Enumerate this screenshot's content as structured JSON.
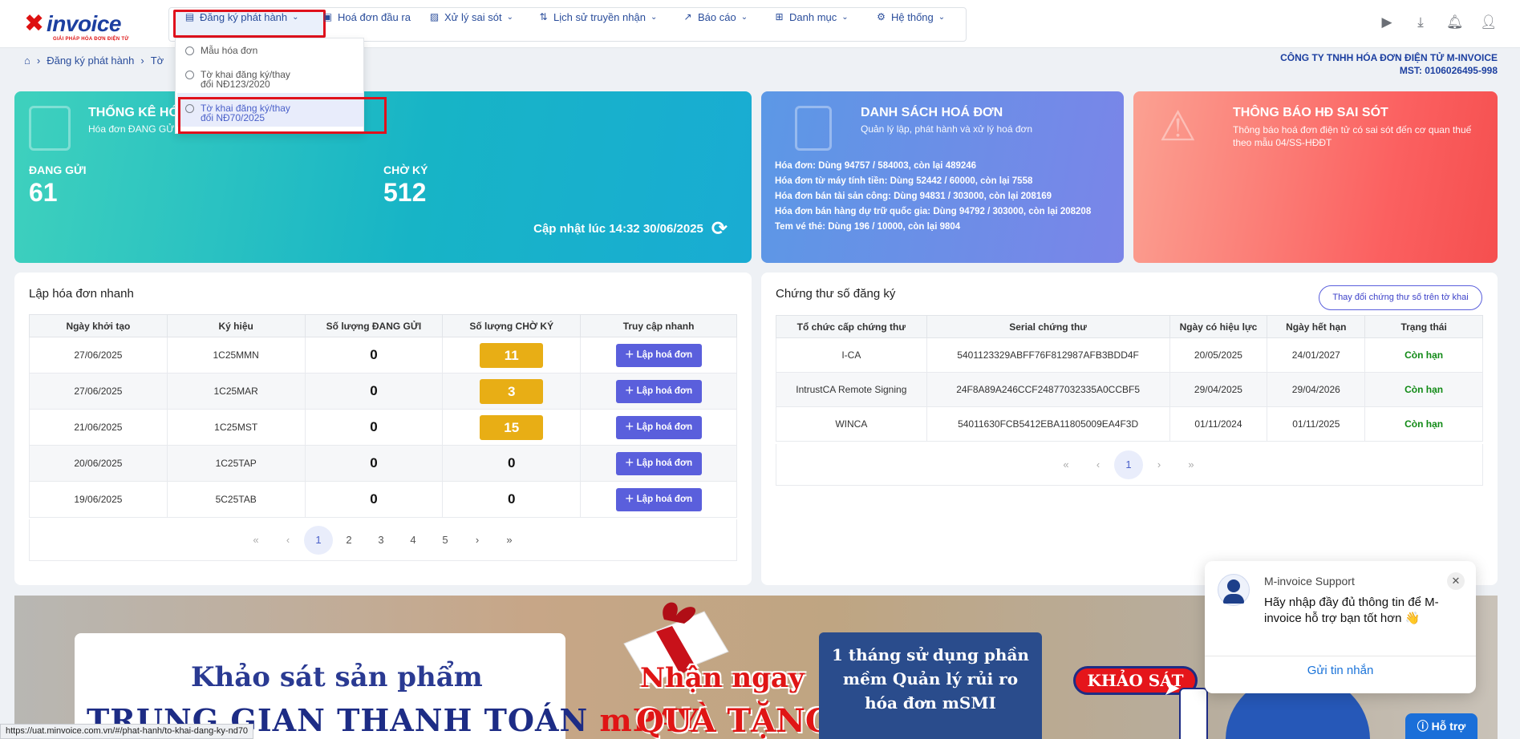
{
  "logo": {
    "mark": "✖",
    "word": "invoice",
    "tagline": "GIẢI PHÁP HÓA ĐƠN ĐIỆN TỬ"
  },
  "nav": [
    {
      "label": "Đăng ký phát hành",
      "icon": "file-register-icon"
    },
    {
      "label": "Hoá đơn đầu ra",
      "icon": "invoice-out-icon"
    },
    {
      "label": "Xử lý sai sót",
      "icon": "error-handling-icon"
    },
    {
      "label": "Lịch sử truyền nhận",
      "icon": "transfer-history-icon"
    },
    {
      "label": "Báo cáo",
      "icon": "chart-icon"
    },
    {
      "label": "Danh mục",
      "icon": "grid-icon"
    },
    {
      "label": "Hệ thống",
      "icon": "gear-icon"
    }
  ],
  "dropdown": {
    "items": [
      "Mẫu hóa đơn",
      "Tờ khai đăng ký/thay đổi NĐ123/2020",
      "Tờ khai đăng ký/thay đổi NĐ70/2025"
    ]
  },
  "breadcrumb": {
    "items": [
      "Đăng ký phát hành",
      "Tờ"
    ]
  },
  "company": {
    "name": "CÔNG TY TNHH HÓA ĐƠN ĐIỆN TỬ M-INVOICE",
    "mst": "MST: 0106026495-998"
  },
  "card_stats": {
    "title": "THỐNG KÊ HÓ",
    "subtitle": "Hóa đơn ĐANG GỬ",
    "sending_label": "ĐANG GỬI",
    "sending_value": "61",
    "pending_label": "CHỜ KÝ",
    "pending_value": "512",
    "updated": "Cập nhật lúc 14:32 30/06/2025"
  },
  "card_invoices": {
    "title": "DANH SÁCH HOÁ ĐƠN",
    "subtitle": "Quản lý lập, phát hành và xử lý hoá đơn",
    "lines": [
      "Hóa đơn: Dùng 94757 / 584003, còn lại 489246",
      "Hóa đơn từ máy tính tiền: Dùng 52442 / 60000, còn lại 7558",
      "Hóa đơn bán tài sản công: Dùng 94831 / 303000, còn lại 208169",
      "Hóa đơn bán hàng dự trữ quốc gia: Dùng 94792 / 303000, còn lại 208208",
      "Tem vé thẻ: Dùng 196 / 10000, còn lại 9804"
    ]
  },
  "card_errors": {
    "title": "THÔNG BÁO HĐ SAI SÓT",
    "subtitle": "Thông báo hoá đơn điện tử có sai sót đến cơ quan thuế theo mẫu 04/SS-HĐĐT"
  },
  "quick_invoice": {
    "title": "Lập hóa đơn nhanh",
    "headers": [
      "Ngày khởi tạo",
      "Ký hiệu",
      "Số lượng ĐANG GỬI",
      "Số lượng CHỜ KÝ",
      "Truy cập nhanh"
    ],
    "button_label": "Lập hoá đơn",
    "rows": [
      {
        "date": "27/06/2025",
        "symbol": "1C25MMN",
        "sending": "0",
        "pending": "11"
      },
      {
        "date": "27/06/2025",
        "symbol": "1C25MAR",
        "sending": "0",
        "pending": "3"
      },
      {
        "date": "21/06/2025",
        "symbol": "1C25MST",
        "sending": "0",
        "pending": "15"
      },
      {
        "date": "20/06/2025",
        "symbol": "1C25TAP",
        "sending": "0",
        "pending": "0"
      },
      {
        "date": "19/06/2025",
        "symbol": "5C25TAB",
        "sending": "0",
        "pending": "0"
      }
    ],
    "pages": [
      "1",
      "2",
      "3",
      "4",
      "5"
    ],
    "current_page": "1"
  },
  "certificates": {
    "title": "Chứng thư số đăng ký",
    "change_button": "Thay đổi chứng thư số trên tờ khai",
    "headers": [
      "Tổ chức cấp chứng thư",
      "Serial chứng thư",
      "Ngày có hiệu lực",
      "Ngày hết hạn",
      "Trạng thái"
    ],
    "rows": [
      {
        "issuer": "I-CA",
        "serial": "5401123329ABFF76F812987AFB3BDD4F",
        "from": "20/05/2025",
        "to": "24/01/2027",
        "status": "Còn hạn"
      },
      {
        "issuer": "IntrustCA Remote Signing",
        "serial": "24F8A89A246CCF24877032335A0CCBF5",
        "from": "29/04/2025",
        "to": "29/04/2026",
        "status": "Còn hạn"
      },
      {
        "issuer": "WINCA",
        "serial": "54011630FCB5412EBA11805009EA4F3D",
        "from": "01/11/2024",
        "to": "01/11/2025",
        "status": "Còn hạn"
      }
    ],
    "pages": [
      "1"
    ],
    "current_page": "1"
  },
  "banner": {
    "line1": "Khảo sát sản phẩm",
    "line2_prefix": "TRUNG GIAN THANH TOÁN ",
    "line2_accent": "mPAY",
    "offer1": "Nhận ngay",
    "offer2": "QUÀ TẶNG",
    "promo": "1 tháng sử dụng phần mềm Quản lý rủi ro hóa đơn mSMI",
    "survey_button": "KHẢO SÁT"
  },
  "chat": {
    "name": "M-invoice Support",
    "message": "Hãy nhập đầy đủ thông tin để M-invoice hỗ trợ bạn tốt hơn 👋",
    "send_label": "Gửi tin nhắn"
  },
  "help_button": "Hỗ trợ",
  "status_url": "https://uat.minvoice.com.vn/#/phat-hanh/to-khai-dang-ky-nd70",
  "colors": {
    "brand": "#1c3fa0",
    "accent": "#5a5fdc",
    "badge": "#e8ae15",
    "ok": "#118a16",
    "highlight": "#e0111c"
  }
}
